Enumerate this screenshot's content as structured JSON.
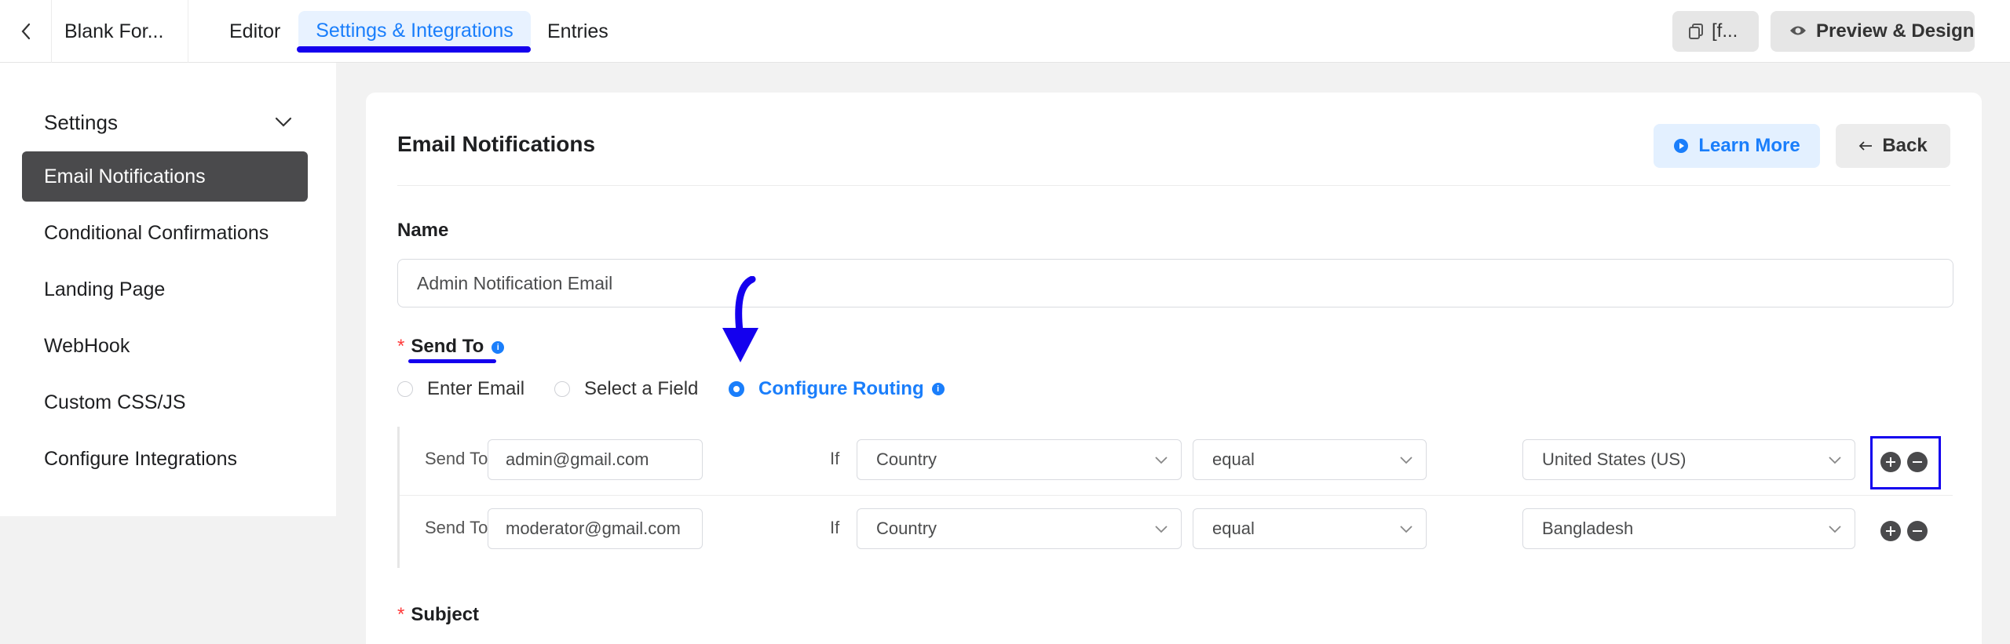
{
  "topbar": {
    "form_title": "Blank For...",
    "tabs": [
      {
        "label": "Editor"
      },
      {
        "label": "Settings & Integrations"
      },
      {
        "label": "Entries"
      }
    ],
    "shortcode_label": "[f...",
    "preview_label": "Preview & Design"
  },
  "sidebar": {
    "heading": "Settings",
    "items": [
      {
        "label": "Email Notifications"
      },
      {
        "label": "Conditional Confirmations"
      },
      {
        "label": "Landing Page"
      },
      {
        "label": "WebHook"
      },
      {
        "label": "Custom CSS/JS"
      },
      {
        "label": "Configure Integrations"
      }
    ]
  },
  "main": {
    "title": "Email Notifications",
    "learn_more": "Learn More",
    "back": "Back",
    "name_label": "Name",
    "name_value": "Admin Notification Email",
    "send_to_label": "Send To",
    "send_to_options": [
      "Enter Email",
      "Select a Field",
      "Configure Routing"
    ],
    "routes": [
      {
        "send_to_label": "Send To",
        "email": "admin@gmail.com",
        "if_label": "If",
        "field": "Country",
        "operator": "equal",
        "value": "United States (US)"
      },
      {
        "send_to_label": "Send To",
        "email": "moderator@gmail.com",
        "if_label": "If",
        "field": "Country",
        "operator": "equal",
        "value": "Bangladesh"
      }
    ],
    "subject_label": "Subject"
  },
  "colors": {
    "accent": "#1a7efb",
    "annotation": "#1400ee",
    "sidebar_active": "#4a4a4c"
  }
}
